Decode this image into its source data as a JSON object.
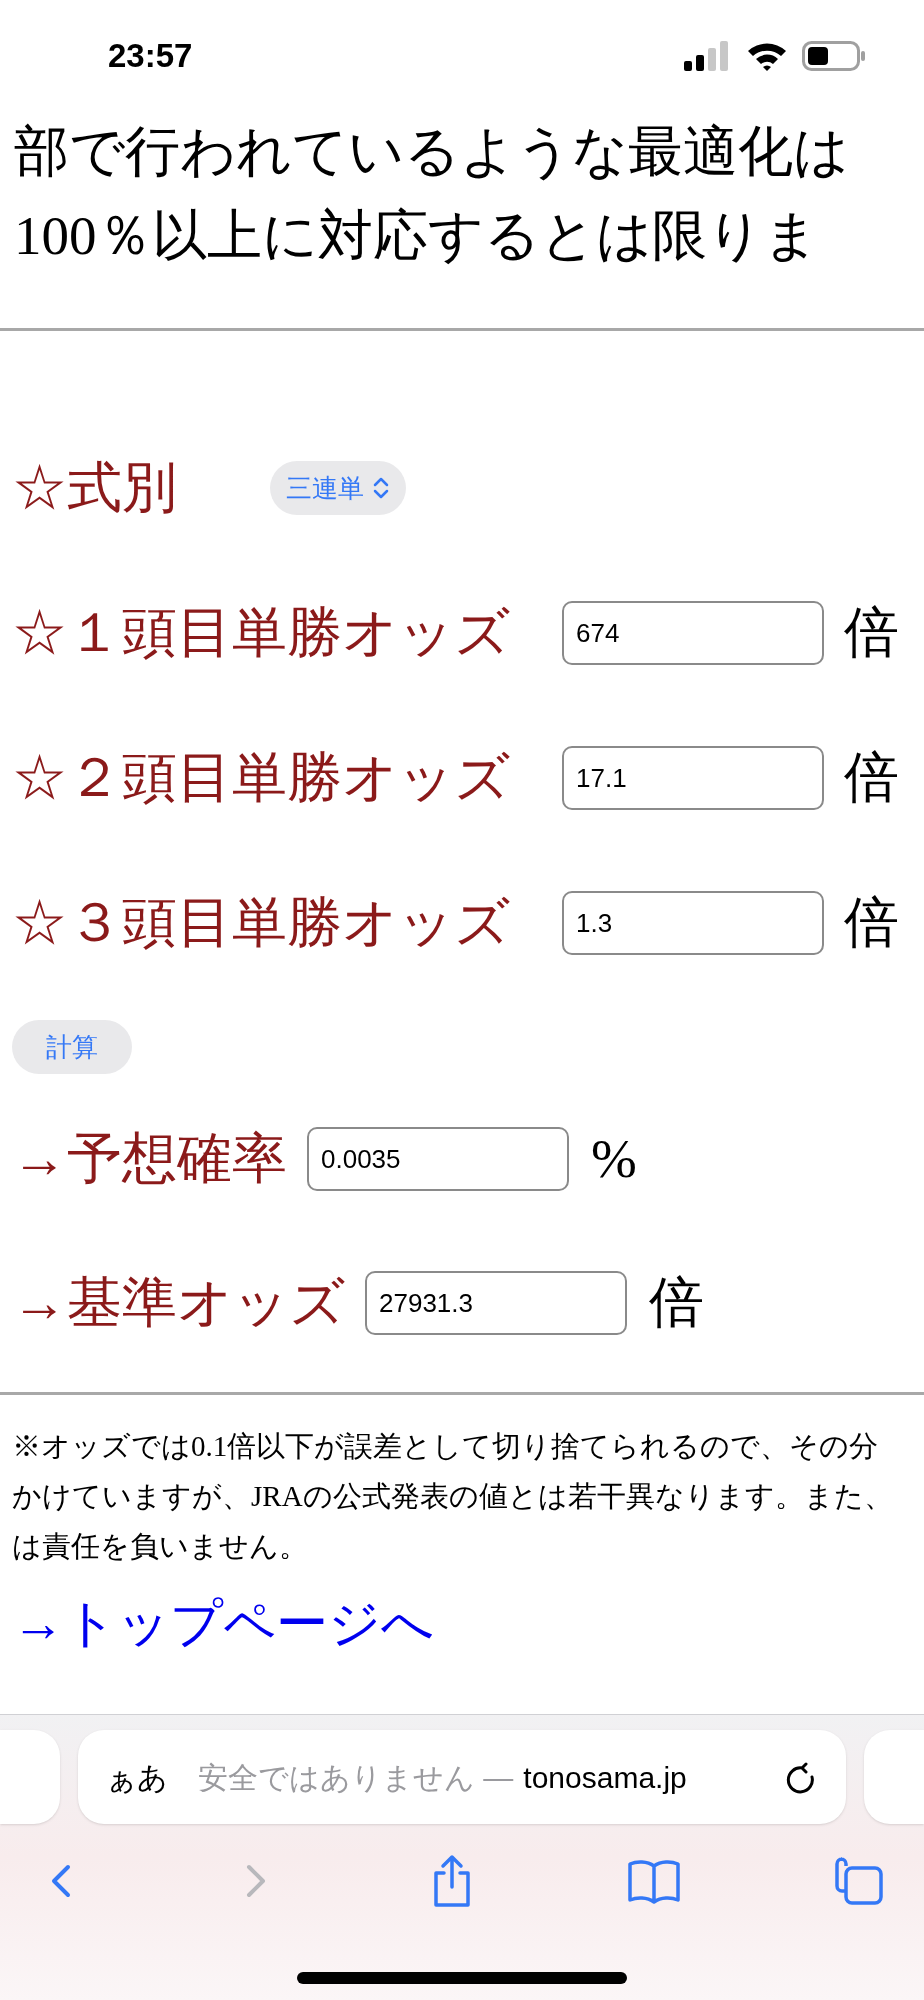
{
  "status_bar": {
    "time": "23:57"
  },
  "intro_lines": [
    "部で行われているような最適化は",
    "100％以上に対応するとは限りま"
  ],
  "bet_type": {
    "label": "☆式別",
    "value": "三連単"
  },
  "odds_rows": [
    {
      "label": "☆１頭目単勝オッズ",
      "value": "674",
      "unit": "倍"
    },
    {
      "label": "☆２頭目単勝オッズ",
      "value": "17.1",
      "unit": "倍"
    },
    {
      "label": "☆３頭目単勝オッズ",
      "value": "1.3",
      "unit": "倍"
    }
  ],
  "calculate_button": "計算",
  "results": [
    {
      "label": "→予想確率",
      "value": "0.0035",
      "unit": "%"
    },
    {
      "label": "→基準オッズ",
      "value": "27931.3",
      "unit": "倍"
    }
  ],
  "notes": [
    "※オッズでは0.1倍以下が誤差として切り捨てられるので、その分",
    "かけていますが、JRAの公式発表の値とは若干異なります。また、",
    "は責任を負いません。"
  ],
  "top_link": "→トップページへ",
  "browser": {
    "text_size_button": "ぁあ",
    "security": "安全ではありません —",
    "host": "tonosama.jp"
  },
  "toolbar": {
    "back": {
      "disabled": false
    },
    "forward": {
      "disabled": true
    }
  }
}
